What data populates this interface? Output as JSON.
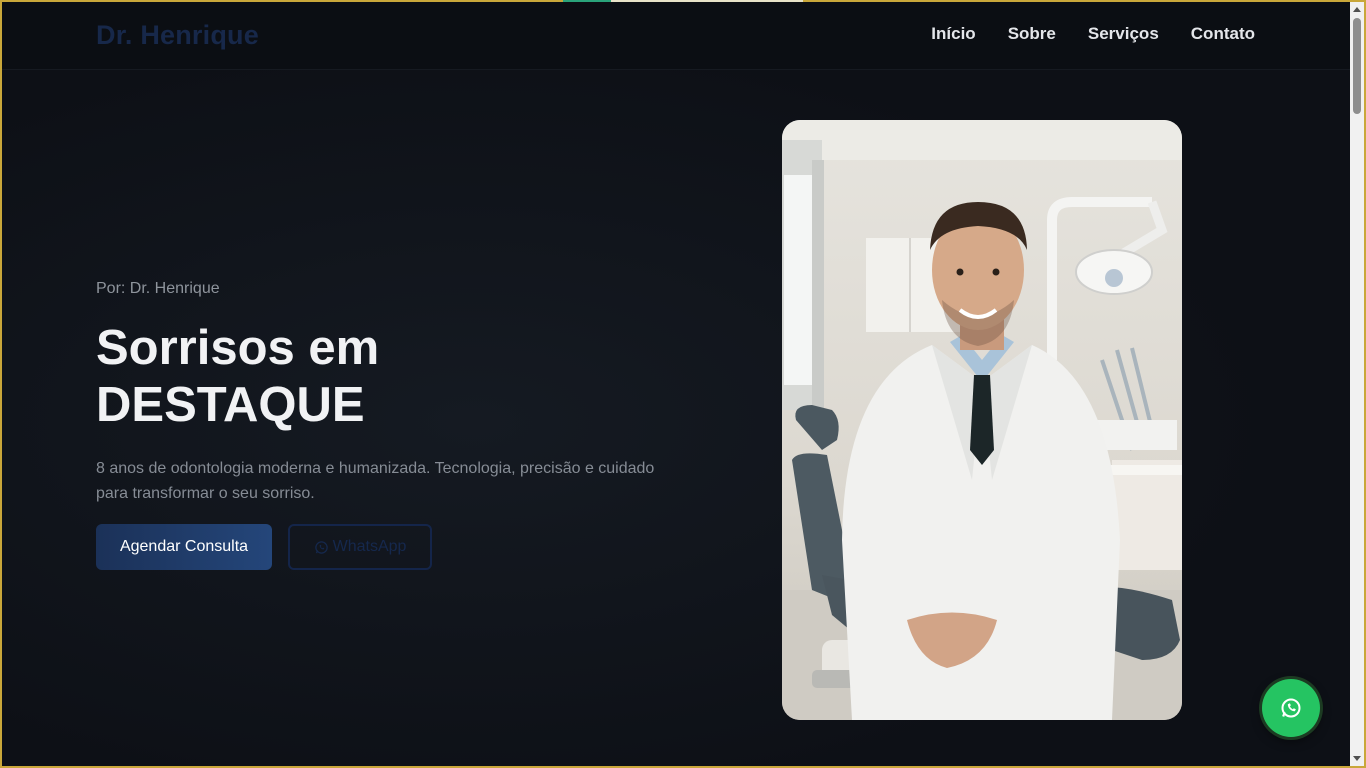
{
  "nav": {
    "brand": "Dr. Henrique",
    "links": [
      "Início",
      "Sobre",
      "Serviços",
      "Contato"
    ]
  },
  "hero": {
    "author": "Por: Dr. Henrique",
    "title_line1": "Sorrisos em",
    "title_line2": "DESTAQUE",
    "description": "8 anos de odontologia moderna e humanizada. Tecnologia, precisão e cuidado para transformar o seu sorriso.",
    "primary_button": "Agendar Consulta",
    "secondary_button": "WhatsApp",
    "secondary_icon": "whatsapp-icon"
  },
  "photo": {
    "subject": "dentist-portrait"
  },
  "floating_button": {
    "icon": "whatsapp-icon",
    "color": "#25c462"
  },
  "colors": {
    "background": "#0d1016",
    "brand": "#17284a",
    "primary_button": "#1f3b68",
    "whatsapp": "#25c462"
  }
}
